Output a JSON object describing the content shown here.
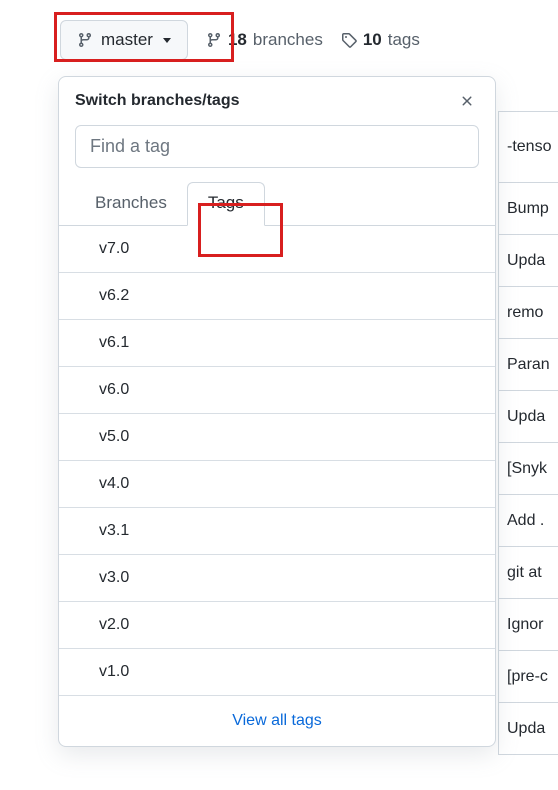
{
  "topBar": {
    "branchLabel": "master",
    "branchesCount": "18",
    "branchesLabel": "branches",
    "tagsCount": "10",
    "tagsLabel": "tags"
  },
  "popover": {
    "title": "Switch branches/tags",
    "searchPlaceholder": "Find a tag",
    "tabs": {
      "branches": "Branches",
      "tags": "Tags"
    },
    "tagList": [
      "v7.0",
      "v6.2",
      "v6.1",
      "v6.0",
      "v5.0",
      "v4.0",
      "v3.1",
      "v3.0",
      "v2.0",
      "v1.0"
    ],
    "viewAll": "View all tags"
  },
  "bgRows": [
    "-tenso",
    "Bump",
    "Upda",
    "remo",
    "Paran",
    "Upda",
    "[Snyk",
    "Add .",
    "git at",
    "Ignor",
    "[pre-c",
    "Upda"
  ]
}
